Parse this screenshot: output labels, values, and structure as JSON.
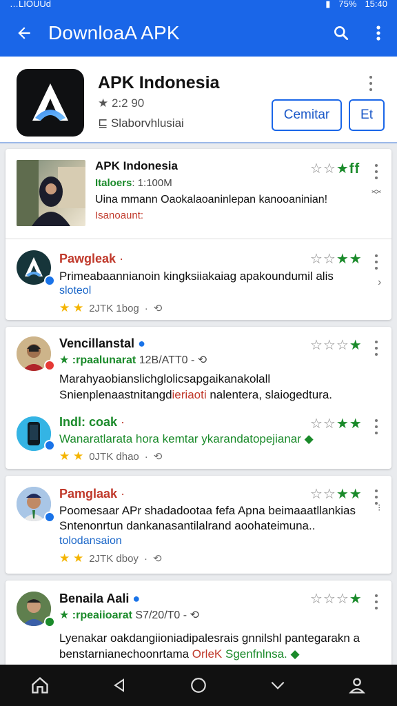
{
  "status_bar": {
    "left_text": "…LIOUUd",
    "battery": "75%",
    "time": "15:40"
  },
  "app_bar": {
    "title": "DownloaA APK",
    "colors": {
      "primary": "#1a66e8"
    },
    "icons": [
      "back-arrow-icon",
      "search-icon",
      "more-vert-icon"
    ]
  },
  "app": {
    "name": "APK Indonesia",
    "rating": "2:2 90",
    "developer": "Slaborvhlusiai",
    "open_label": "Cemitar",
    "et_label": "Et"
  },
  "featured": {
    "name": "APK Indonesia",
    "meta_green": "Italoers",
    "meta": ": 1:100M",
    "text": "Uina mmann Oaokalaoaninlepan kanooaninian!",
    "link": "Isanoaunt:"
  },
  "reviews": [
    {
      "name": "Pawgleak",
      "name_color": "#c0392b",
      "text1": "Primeabaannianoin kingksiiakaiag apakoundumil alis",
      "link": "sloteol",
      "foot": "2JTK  1bog",
      "stars_on": 2
    },
    {
      "name": "Vencillanstal",
      "name_color": "#111111",
      "meta_green": "★ :rpaalunarat",
      "meta": "12B/ATT0 -",
      "text1": "Marahyaobianslichglolicsapgaikanakolall",
      "text2_a": "Snienplenaastnitangd",
      "text2_red": "ieriaoti",
      "text2_b": " nalentera, slaiogedtura.",
      "stars_on": 1
    },
    {
      "name": "Indl: coak",
      "name_color": "#1a8a2a",
      "text1": "Wanaratlarata hora kemtar ykarandatopejianar",
      "foot": "0JTK  dhao",
      "stars_on": 2
    },
    {
      "name": "Pamglaak",
      "name_color": "#c0392b",
      "text1": "Poomesaar APr shadadootaa fefa Apna beimaaatllankias",
      "text2": "Sntenonrtun dankanasantilalrand aoohateimuna..",
      "link": "tolodansaion",
      "foot": "2JTK  dboy",
      "stars_on": 2
    },
    {
      "name": "Benaila Aali",
      "name_color": "#111111",
      "meta_green": "★ :rpeaiioarat",
      "meta": "S7/20/T0 -",
      "text1": "Lyenakar oakdangiioniadipalesrais gnnilshl pantegarakn a",
      "text2_a": "benstarnianechoonrtama",
      "text2_red": " OrleK ",
      "text2_b": "Sgenfnlnsa.",
      "stars_on": 1
    }
  ],
  "nav_bar": {
    "icons": [
      "home-icon",
      "back-triangle-icon",
      "home-circle-icon",
      "chevron-down-icon",
      "profile-icon"
    ]
  }
}
